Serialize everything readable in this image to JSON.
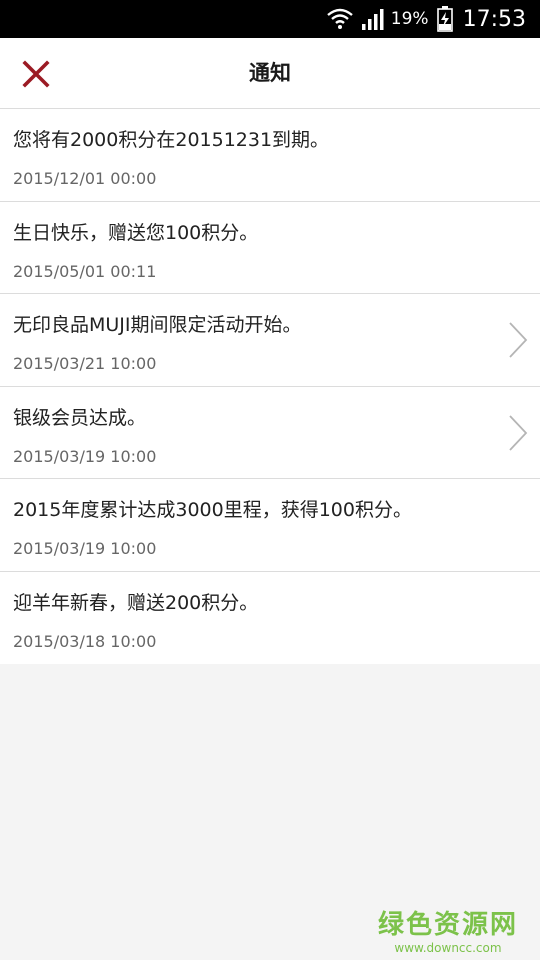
{
  "status_bar": {
    "battery_percent": "19%",
    "time": "17:53",
    "icons": [
      "wifi-icon",
      "signal-icon",
      "battery-charging-icon"
    ]
  },
  "header": {
    "title": "通知",
    "close_icon": "close-icon",
    "accent_color": "#9b1b24"
  },
  "notifications": [
    {
      "message": "您将有2000积分在20151231到期。",
      "time": "2015/12/01 00:00",
      "has_chevron": false
    },
    {
      "message": "生日快乐，赠送您100积分。",
      "time": "2015/05/01 00:11",
      "has_chevron": false
    },
    {
      "message": "无印良品MUJI期间限定活动开始。",
      "time": "2015/03/21 10:00",
      "has_chevron": true
    },
    {
      "message": "银级会员达成。",
      "time": "2015/03/19 10:00",
      "has_chevron": true
    },
    {
      "message": "2015年度累计达成3000里程，获得100积分。",
      "time": "2015/03/19 10:00",
      "has_chevron": false
    },
    {
      "message": "迎羊年新春，赠送200积分。",
      "time": "2015/03/18 10:00",
      "has_chevron": false
    }
  ],
  "watermark": {
    "main": "绿色资源网",
    "sub": "www.downcc.com",
    "color": "#7cc24a"
  }
}
